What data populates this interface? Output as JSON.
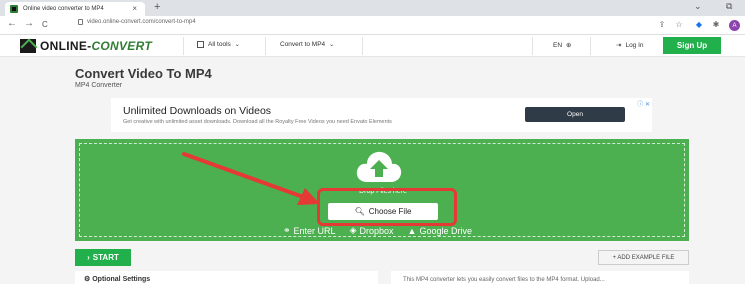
{
  "browser": {
    "tab_title": "Online video converter to MP4",
    "tab_close": "×",
    "new_tab": "+",
    "url": "video.online-convert.com/convert-to-mp4",
    "back": "←",
    "forward": "→",
    "reload": "C",
    "minimize": "⌄",
    "restore": "⧉",
    "profile_initial": "A"
  },
  "navbar": {
    "logo_main": "ONLINE-",
    "logo_accent": "CONVERT",
    "all_tools": "All tools",
    "convert_to": "Convert to MP4",
    "language": "EN",
    "login": "Log In",
    "signup": "Sign Up"
  },
  "page": {
    "title": "Convert Video To MP4",
    "subtitle": "MP4 Converter"
  },
  "ad": {
    "title": "Unlimited Downloads on Videos",
    "description": "Get creative with unlimited asset downloads. Download all the Royalty Free Videos you need Envato Elements",
    "button": "Open",
    "badge": "ⓘ ✕"
  },
  "upload": {
    "drop_text": "Drop Files here",
    "choose_file": "Choose File",
    "sources": [
      "Enter URL",
      "Dropbox",
      "Google Drive"
    ]
  },
  "actions": {
    "start": "START",
    "add_example": "+ ADD EXAMPLE FILE"
  },
  "options": {
    "title": "Optional Settings"
  },
  "description": {
    "text": "This MP4 converter lets you easily convert files to the MP4 format. Upload..."
  },
  "colors": {
    "brand_green": "#21b04b",
    "dropzone_green": "#4caf50",
    "highlight_red": "#e53935"
  }
}
